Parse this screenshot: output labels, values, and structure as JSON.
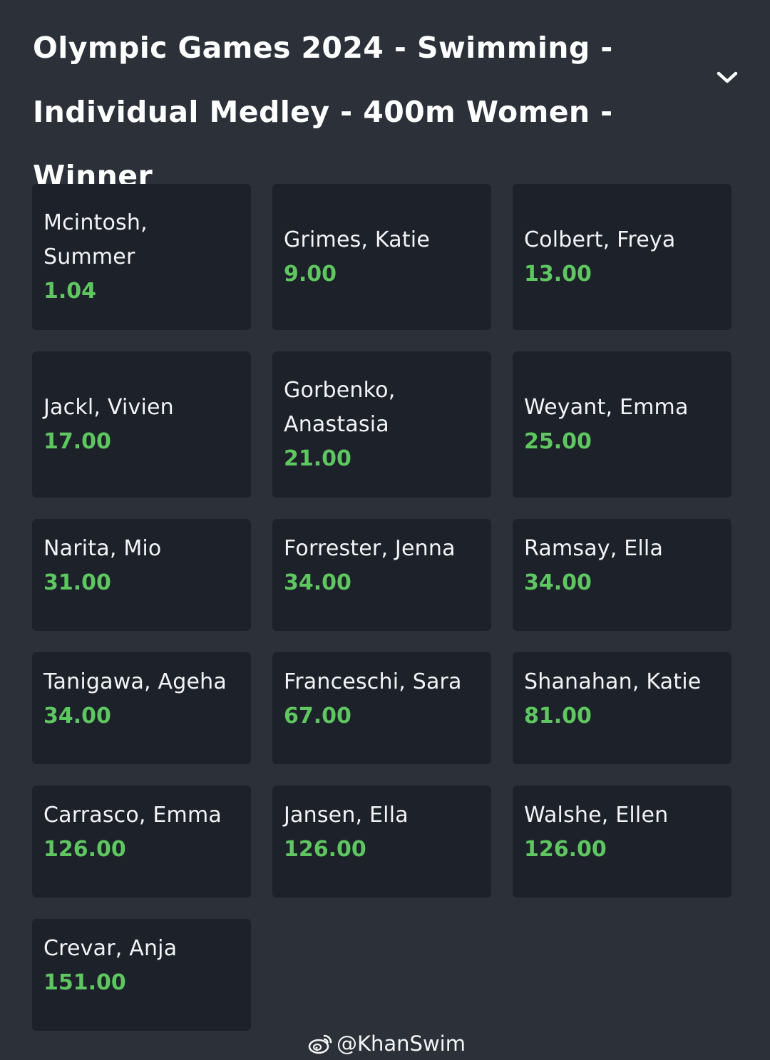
{
  "market": {
    "title": "Olympic Games 2024 - Swimming - Individual Medley - 400m Women - Winner"
  },
  "runners": [
    {
      "name": "Mcintosh, Summer",
      "odds": "1.04"
    },
    {
      "name": "Grimes, Katie",
      "odds": "9.00"
    },
    {
      "name": "Colbert, Freya",
      "odds": "13.00"
    },
    {
      "name": "Jackl, Vivien",
      "odds": "17.00"
    },
    {
      "name": "Gorbenko, Anastasia",
      "odds": "21.00"
    },
    {
      "name": "Weyant, Emma",
      "odds": "25.00"
    },
    {
      "name": "Narita, Mio",
      "odds": "31.00"
    },
    {
      "name": "Forrester, Jenna",
      "odds": "34.00"
    },
    {
      "name": "Ramsay, Ella",
      "odds": "34.00"
    },
    {
      "name": "Tanigawa, Ageha",
      "odds": "34.00"
    },
    {
      "name": "Franceschi, Sara",
      "odds": "67.00"
    },
    {
      "name": "Shanahan, Katie",
      "odds": "81.00"
    },
    {
      "name": "Carrasco, Emma",
      "odds": "126.00"
    },
    {
      "name": "Jansen, Ella",
      "odds": "126.00"
    },
    {
      "name": "Walshe, Ellen",
      "odds": "126.00"
    },
    {
      "name": "Crevar, Anja",
      "odds": "151.00"
    }
  ],
  "watermark": {
    "text": "@KhanSwim",
    "icon": "weibo-icon"
  },
  "icons": {
    "collapse": "chevron-down-icon"
  },
  "colors": {
    "background": "#2b3039",
    "card": "#1d212a",
    "odds": "#5ec760",
    "text": "#f2f3f5"
  }
}
